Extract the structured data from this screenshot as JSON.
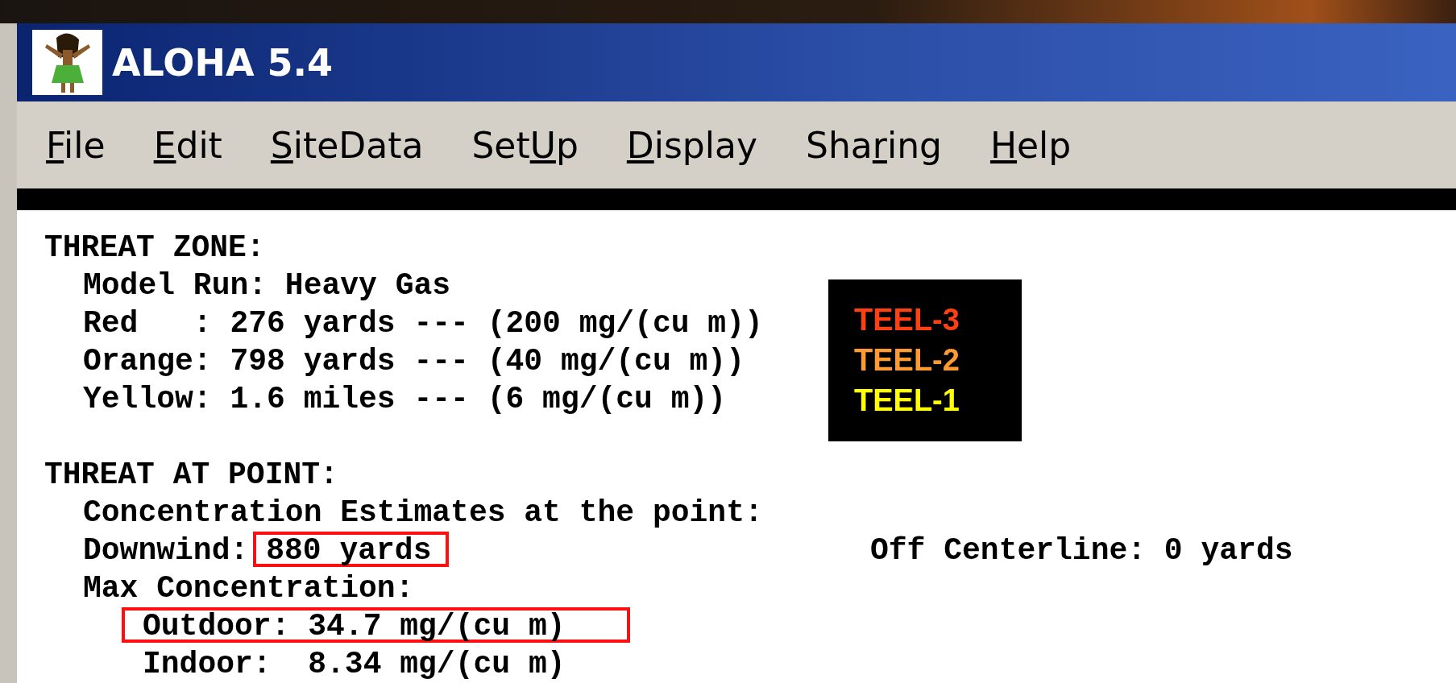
{
  "window": {
    "title": "ALOHA 5.4"
  },
  "menu": [
    {
      "access_key": "F",
      "after_key": "ile"
    },
    {
      "access_key": "E",
      "after_key": "dit"
    },
    {
      "access_key": "S",
      "after_key": "iteData"
    },
    {
      "before_key": "Set",
      "access_key": "U",
      "after_key": "p"
    },
    {
      "access_key": "D",
      "after_key": "isplay"
    },
    {
      "before_key": "Sha",
      "access_key": "r",
      "after_key": "ing"
    },
    {
      "access_key": "H",
      "after_key": "elp"
    }
  ],
  "sections": [
    {
      "heading": "THREAT ZONE:",
      "lines": [
        {
          "text": "Model Run: Heavy Gas"
        },
        {
          "text": "Red   : 276 yards --- (200 mg/(cu m))"
        },
        {
          "text": "Orange: 798 yards --- (40 mg/(cu m))"
        },
        {
          "text": "Yellow: 1.6 miles --- (6 mg/(cu m))"
        }
      ]
    },
    {
      "heading": "THREAT AT POINT:",
      "lines": [
        {
          "text": "Concentration Estimates at the point:"
        },
        {
          "text": "Downwind:",
          "value": "880 yards",
          "kind": "value-boxed",
          "aside": "Off Centerline: 0 yards"
        },
        {
          "text": "Max Concentration:",
          "children": [
            {
              "text": "Outdoor:",
              "value": "34.7 mg/(cu m)",
              "kind": "line-boxed"
            },
            {
              "text": "Indoor: ",
              "value": "8.34 mg/(cu m)"
            }
          ]
        }
      ]
    }
  ],
  "legend": [
    {
      "label": "TEEL-3",
      "color": "#ff4010"
    },
    {
      "label": "TEEL-2",
      "color": "#ff9a30"
    },
    {
      "label": "TEEL-1",
      "color": "#ffff00"
    }
  ]
}
